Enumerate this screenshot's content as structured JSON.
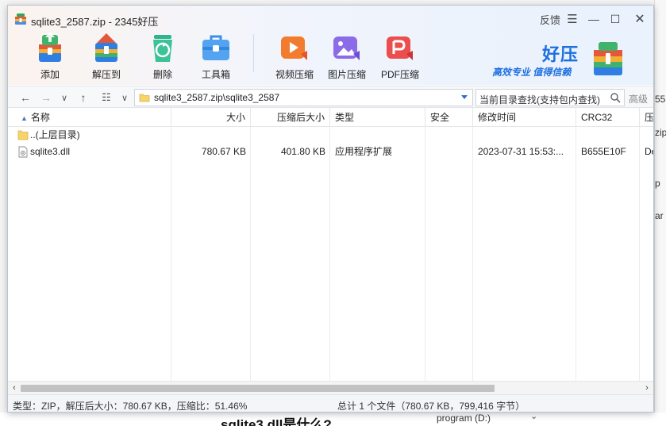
{
  "window": {
    "title": "sqlite3_2587.zip - 2345好压",
    "feedback": "反馈",
    "menu_glyph": "☰",
    "minimize_glyph": "—",
    "maximize_glyph": "☐",
    "close_glyph": "✕"
  },
  "toolbar": {
    "add": "添加",
    "extract_to": "解压到",
    "delete": "删除",
    "toolbox": "工具箱",
    "video_compress": "视频压缩",
    "image_compress": "图片压缩",
    "pdf_compress": "PDF压缩"
  },
  "brand": {
    "name": "好压",
    "slogan": "高效专业 值得信赖"
  },
  "nav": {
    "path": "sqlite3_2587.zip\\sqlite3_2587",
    "search_placeholder": "当前目录查找(支持包内查找)",
    "advanced": "高级"
  },
  "table": {
    "columns": {
      "name": "名称",
      "size": "大小",
      "packed": "压缩后大小",
      "type": "类型",
      "security": "安全",
      "modified": "修改时间",
      "crc": "CRC32",
      "extra": "压"
    },
    "rows": [
      {
        "name": "..(上层目录)",
        "size": "",
        "packed": "",
        "type": "",
        "modified": "",
        "crc": "",
        "extra": ""
      },
      {
        "name": "sqlite3.dll",
        "size": "780.67 KB",
        "packed": "401.80 KB",
        "type": "应用程序扩展",
        "modified": "2023-07-31 15:53:...",
        "crc": "B655E10F",
        "extra": "De"
      }
    ]
  },
  "status": {
    "left": "类型：ZIP，解压后大小：780.67 KB，压缩比：51.46%",
    "right": "总计 1 个文件（780.67 KB，799,416 字节）"
  },
  "background": {
    "frag1": "55",
    "frag2": "zip",
    "frag3": "p",
    "frag4": "ar",
    "heading": "sqlite3.dll是什么?",
    "drive": "program (D:)"
  },
  "colors": {
    "accent": "#1c6fe0",
    "folder": "#f7d36b"
  }
}
